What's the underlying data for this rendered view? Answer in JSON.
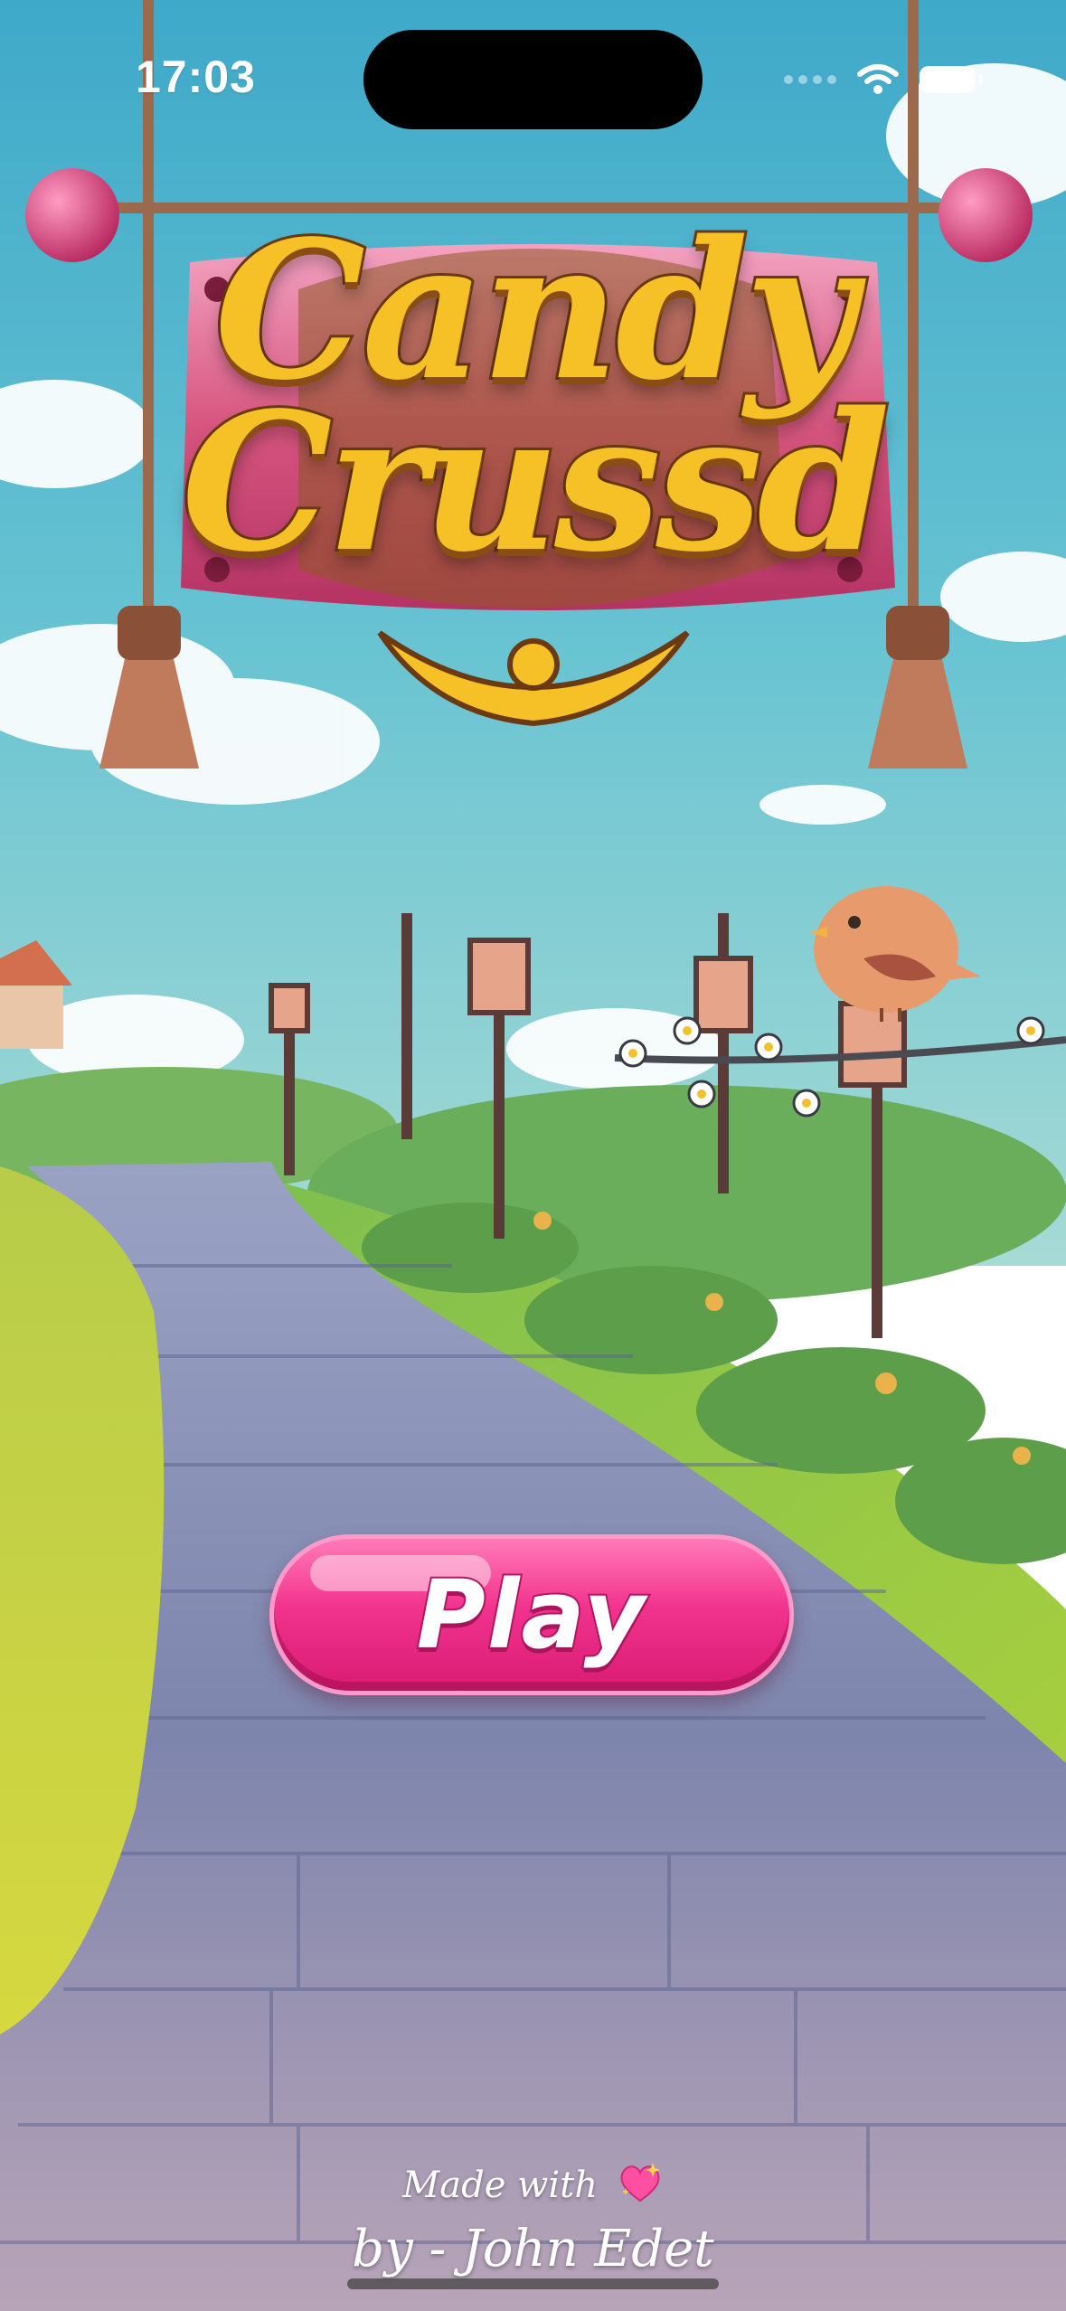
{
  "status_bar": {
    "time": "17:03"
  },
  "logo": {
    "line1": "Candy",
    "line2": "Crussd"
  },
  "play_button": {
    "label": "Play"
  },
  "credits": {
    "made_with": "Made with",
    "author": "by - John Edet"
  },
  "icons": {
    "wifi": "wifi-icon",
    "battery": "battery-icon",
    "heart": "sparkling-heart-icon",
    "bird": "bird-icon"
  },
  "colors": {
    "play_pink": "#f2338d",
    "logo_gold": "#f6c126",
    "sky": "#5fc0d3",
    "grass": "#c7d43a",
    "path": "#8a8fb0"
  }
}
